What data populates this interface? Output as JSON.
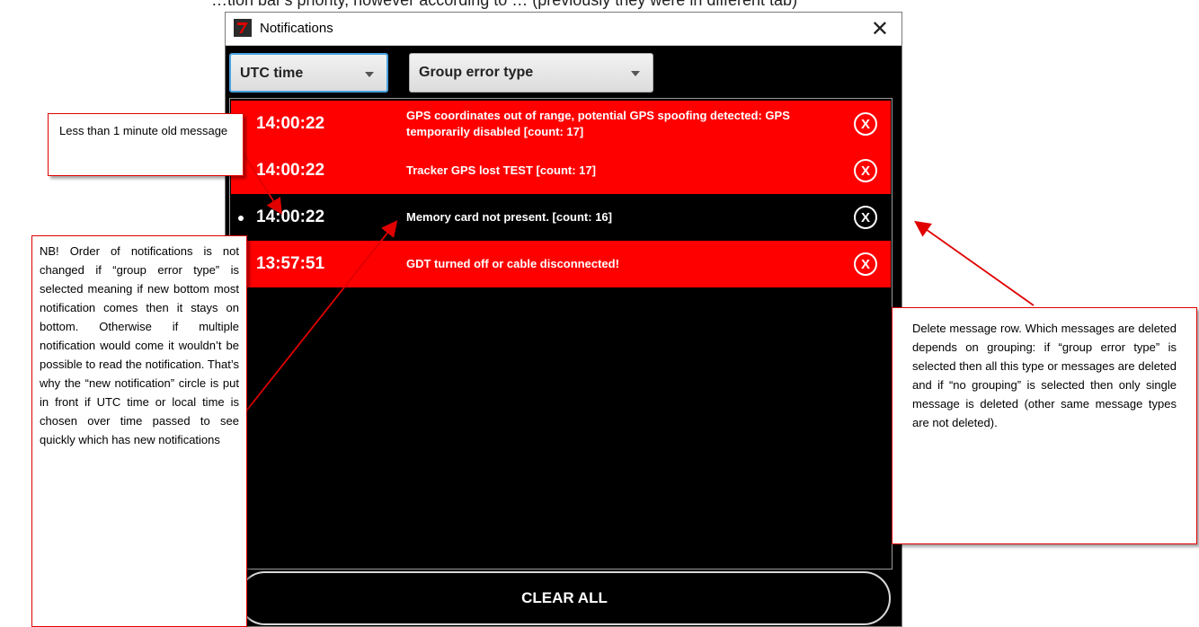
{
  "top_caption": "…tion bar's priority, however according to … (previously they were in different tab)",
  "window": {
    "title": "Notifications",
    "close_glyph": "✕"
  },
  "dropdowns": {
    "time_mode": "UTC time",
    "grouping": "Group error type"
  },
  "notifications": [
    {
      "time": "14:00:22",
      "message": "GPS coordinates out of range, potential GPS spoofing detected: GPS temporarily disabled   [count: 17]",
      "color": "#ff0000",
      "new": false
    },
    {
      "time": "14:00:22",
      "message": "Tracker GPS lost TEST   [count: 17]",
      "color": "#ff0000",
      "new": false
    },
    {
      "time": "14:00:22",
      "message": "Memory card not present.   [count: 16]",
      "color": "#000000",
      "new": true
    },
    {
      "time": "13:57:51",
      "message": "GDT turned off or cable disconnected!",
      "color": "#ff0000",
      "new": false
    }
  ],
  "delete_glyph": "X",
  "clear_all_label": "CLEAR ALL",
  "annotations": {
    "new_message": "Less than 1 minute old message",
    "order_note": "NB! Order of notifications is not changed if “group error type” is selected meaning if new bottom most notification comes then it stays on bottom. Otherwise if multiple notification would come it wouldn’t be possible to read the notification. That’s why the “new notification” circle is put in front if UTC time or local time is chosen over time passed to see quickly which has new notifications",
    "delete_note": "Delete message row. Which messages are deleted depends on grouping: if “group error type” is selected then all this type or messages are deleted and if “no grouping” is selected then only single message is deleted (other same message types are not deleted)."
  },
  "colors": {
    "accent_red": "#ff0000",
    "focus_blue": "#4aa3df",
    "annotation_border": "#e00000"
  }
}
